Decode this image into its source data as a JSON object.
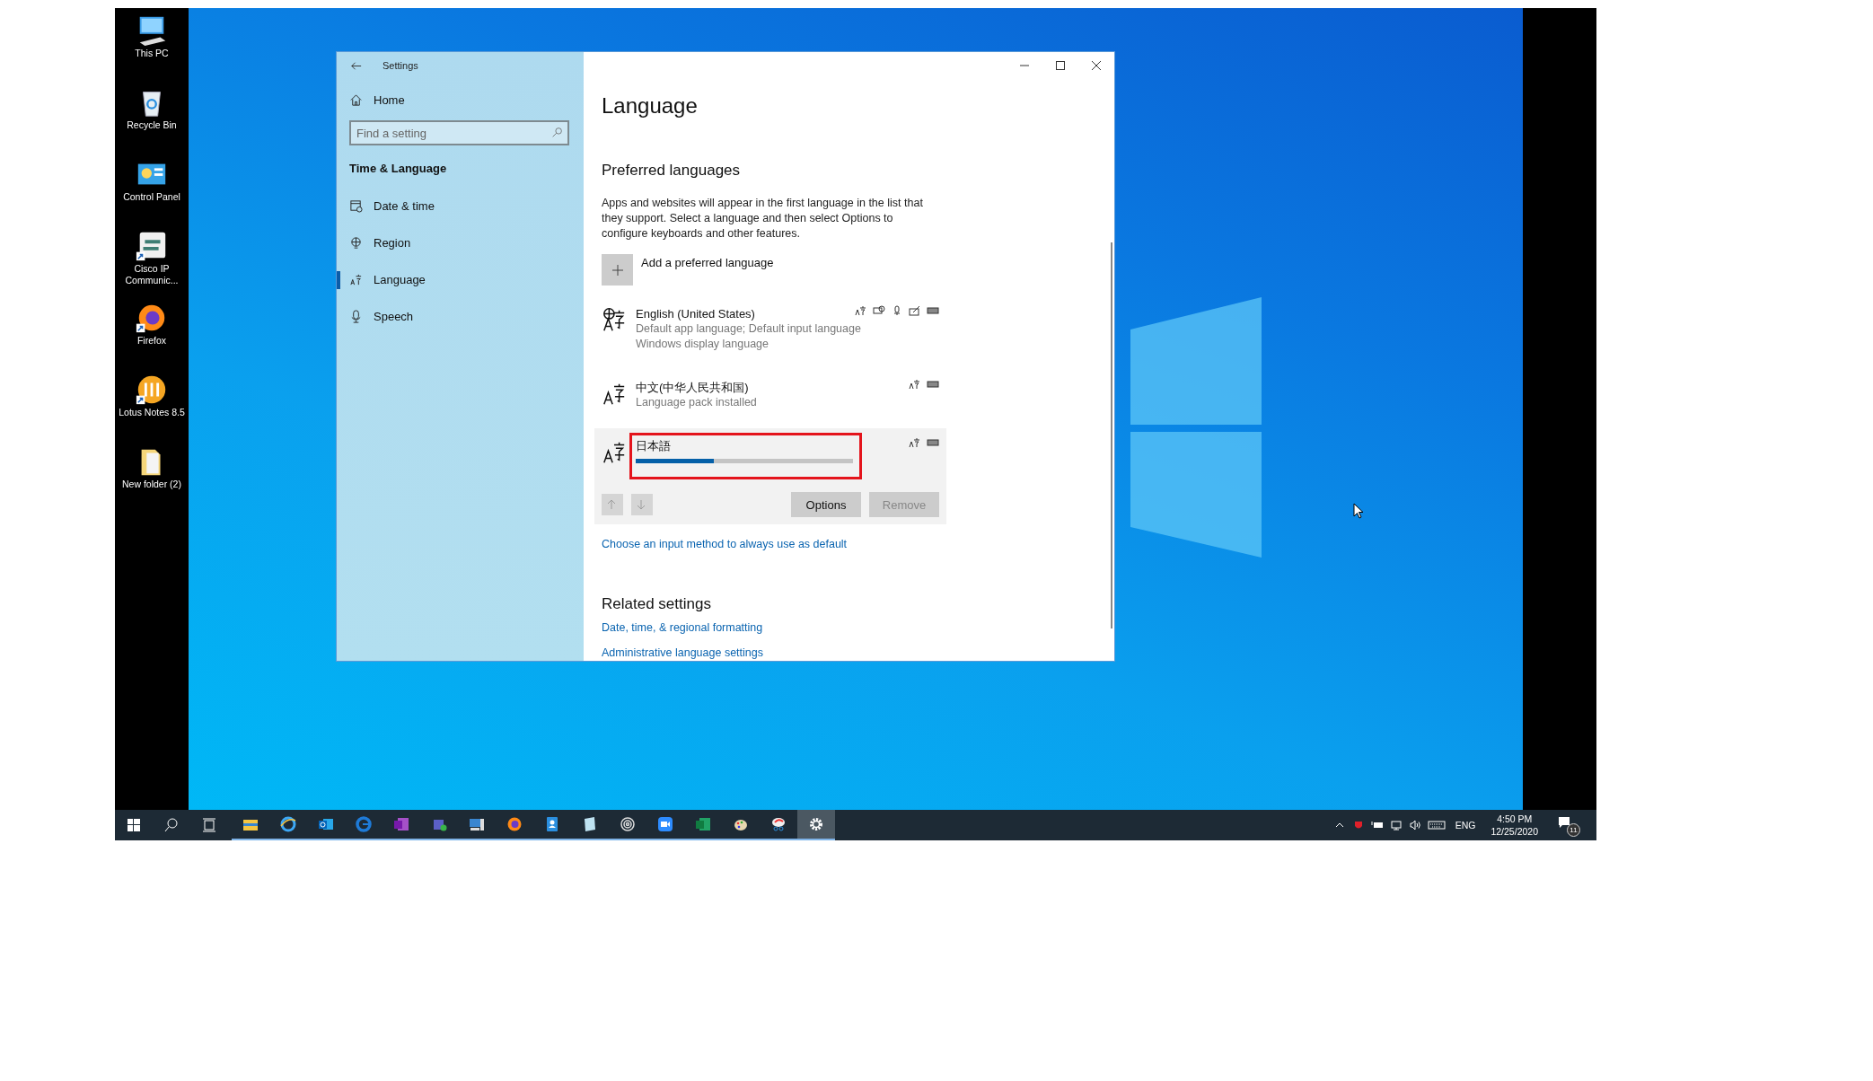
{
  "desktop_icons": [
    {
      "label": "This PC",
      "kind": "pc",
      "shortcut": false
    },
    {
      "label": "Recycle Bin",
      "kind": "bin",
      "shortcut": false
    },
    {
      "label": "Control Panel",
      "kind": "panel",
      "shortcut": false
    },
    {
      "label": "Cisco IP Communic...",
      "kind": "cisco",
      "shortcut": true
    },
    {
      "label": "Firefox",
      "kind": "firefox",
      "shortcut": true
    },
    {
      "label": "Lotus Notes 8.5",
      "kind": "lotus",
      "shortcut": true
    },
    {
      "label": "New folder (2)",
      "kind": "folder",
      "shortcut": false
    }
  ],
  "settings": {
    "title": "Settings",
    "home": "Home",
    "search": {
      "placeholder": "Find a setting"
    },
    "section": "Time & Language",
    "nav": [
      {
        "label": "Date & time",
        "kind": "calendar",
        "selected": false
      },
      {
        "label": "Region",
        "kind": "globe",
        "selected": false
      },
      {
        "label": "Language",
        "kind": "language",
        "selected": true
      },
      {
        "label": "Speech",
        "kind": "mic",
        "selected": false
      }
    ],
    "page_title": "Language",
    "preferred_heading": "Preferred languages",
    "description": "Apps and websites will appear in the first language in the list that they support. Select a language and then select Options to configure keyboards and other features.",
    "add_label": "Add a preferred language",
    "languages": [
      {
        "name": "English (United States)",
        "kind": "display",
        "details": [
          "Default app language; Default input language",
          "Windows display language"
        ],
        "features": [
          {
            "kind": "language"
          },
          {
            "kind": "speech"
          },
          {
            "kind": "mic"
          },
          {
            "kind": "handwriting"
          },
          {
            "kind": "keyboard"
          }
        ],
        "selected": false,
        "highlighted": false
      },
      {
        "name": "中文(中华人民共和国)",
        "kind": "pack",
        "details": [
          "Language pack installed"
        ],
        "features": [
          {
            "kind": "language"
          },
          {
            "kind": "keyboard"
          }
        ],
        "selected": false,
        "highlighted": false
      },
      {
        "name": "日本語",
        "kind": "pack",
        "level": 0.36,
        "features": [
          {
            "kind": "language"
          },
          {
            "kind": "keyboard"
          }
        ],
        "selected": true,
        "highlighted": true
      }
    ],
    "move_up": {
      "disabled": true
    },
    "move_down": {
      "disabled": true
    },
    "options_button": {
      "label": "Options",
      "disabled": false
    },
    "remove_button": {
      "label": "Remove",
      "disabled": true
    },
    "input_method_link": "Choose an input method to always use as default",
    "related_heading": "Related settings",
    "related_links": [
      "Date, time, & regional formatting",
      "Administrative language settings"
    ]
  },
  "taskbar": {
    "apps": [
      {
        "kind": "start",
        "running": false,
        "active": false
      },
      {
        "kind": "search",
        "running": false,
        "active": false
      },
      {
        "kind": "taskview",
        "running": false,
        "active": false
      },
      {
        "kind": "folder",
        "running": true,
        "active": false
      },
      {
        "kind": "ie",
        "running": true,
        "active": false
      },
      {
        "kind": "outlook",
        "running": true,
        "active": false
      },
      {
        "kind": "edge",
        "running": true,
        "active": false
      },
      {
        "kind": "onenote",
        "running": true,
        "active": false
      },
      {
        "kind": "teams",
        "running": true,
        "active": false
      },
      {
        "kind": "computer",
        "running": true,
        "active": false
      },
      {
        "kind": "firefox",
        "running": true,
        "active": false
      },
      {
        "kind": "contacts",
        "running": true,
        "active": false
      },
      {
        "kind": "notepad",
        "running": true,
        "active": false
      },
      {
        "kind": "spiral",
        "running": true,
        "active": false
      },
      {
        "kind": "camera",
        "running": true,
        "active": false
      },
      {
        "kind": "excel",
        "running": true,
        "active": false
      },
      {
        "kind": "paint",
        "running": true,
        "active": false
      },
      {
        "kind": "snip",
        "running": true,
        "active": false
      },
      {
        "kind": "gear",
        "running": true,
        "active": true
      }
    ],
    "input_language": "ENG",
    "time": "4:50 PM",
    "date": "12/25/2020",
    "notifications": "11"
  }
}
